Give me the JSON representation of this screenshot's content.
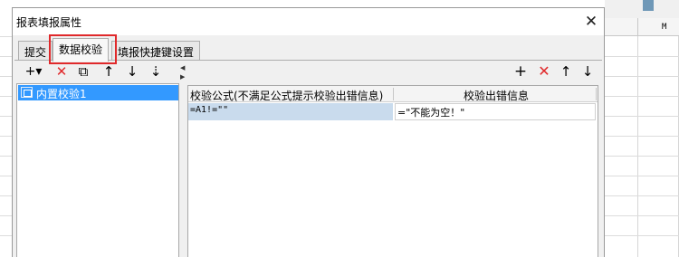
{
  "dialog": {
    "title": "报表填报属性",
    "close_glyph": "✕"
  },
  "tabs": [
    {
      "label": "提交"
    },
    {
      "label": "数据校验",
      "active": true
    },
    {
      "label": "填报快捷键设置"
    }
  ],
  "left_toolbar": {
    "add_glyph": "+▾",
    "delete_glyph": "✕",
    "copy_glyph": "⧉",
    "up_glyph": "↑",
    "down_glyph": "↓",
    "sort_glyph": "⇣"
  },
  "validation_list": {
    "items": [
      {
        "label": "内置校验1",
        "selected": true
      }
    ]
  },
  "right_toolbar": {
    "add_glyph": "+",
    "delete_glyph": "✕",
    "up_glyph": "↑",
    "down_glyph": "↓"
  },
  "grid": {
    "headers": [
      "校验公式(不满足公式提示校验出错信息)",
      "校验出错信息"
    ],
    "rows": [
      {
        "formula": "=A1!=\"\"",
        "message": "=\"不能为空！\""
      }
    ]
  },
  "spreadsheet": {
    "column_label": "M"
  },
  "colors": {
    "selection": "#3399ff",
    "highlight_border": "#e0292b",
    "delete_red": "#e0292b"
  }
}
